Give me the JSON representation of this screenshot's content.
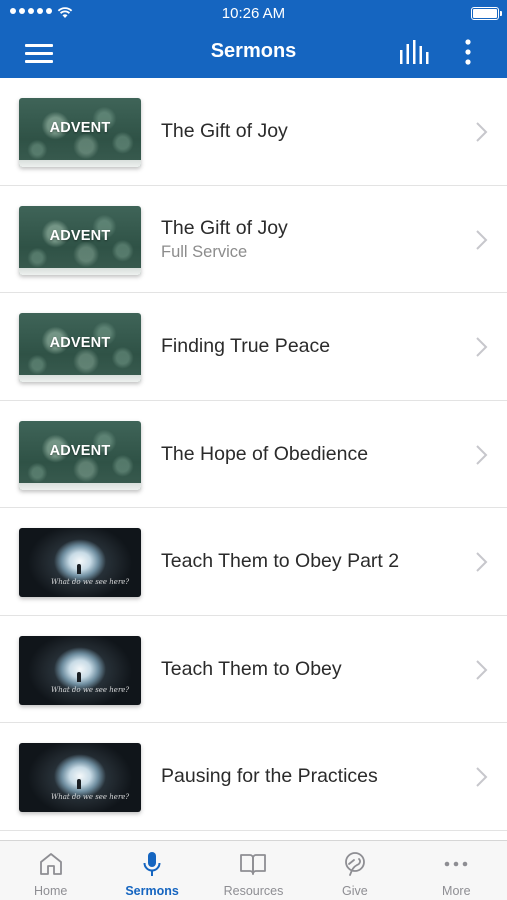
{
  "status_bar": {
    "time": "10:26 AM"
  },
  "nav": {
    "title": "Sermons"
  },
  "sermons": [
    {
      "thumb_text": "ADVENT",
      "title": "The Gift of Joy",
      "subtitle": ""
    },
    {
      "thumb_text": "ADVENT",
      "title": "The Gift of Joy",
      "subtitle": "Full Service"
    },
    {
      "thumb_text": "ADVENT",
      "title": "Finding True Peace",
      "subtitle": ""
    },
    {
      "thumb_text": "ADVENT",
      "title": "The Hope of Obedience",
      "subtitle": ""
    },
    {
      "thumb_text": "What do we see here?",
      "title": "Teach Them to Obey Part 2",
      "subtitle": ""
    },
    {
      "thumb_text": "What do we see here?",
      "title": "Teach Them to Obey",
      "subtitle": ""
    },
    {
      "thumb_text": "What do we see here?",
      "title": "Pausing for the Practices",
      "subtitle": ""
    }
  ],
  "tabs": [
    {
      "label": "Home",
      "icon": "house-icon"
    },
    {
      "label": "Sermons",
      "icon": "microphone-icon"
    },
    {
      "label": "Resources",
      "icon": "book-icon"
    },
    {
      "label": "Give",
      "icon": "give-icon"
    },
    {
      "label": "More",
      "icon": "ellipsis-icon"
    }
  ],
  "colors": {
    "primary": "#1565c0",
    "tab_inactive": "#8e8e93",
    "text": "#2b2b2b",
    "subtitle": "#8c8c8c"
  }
}
